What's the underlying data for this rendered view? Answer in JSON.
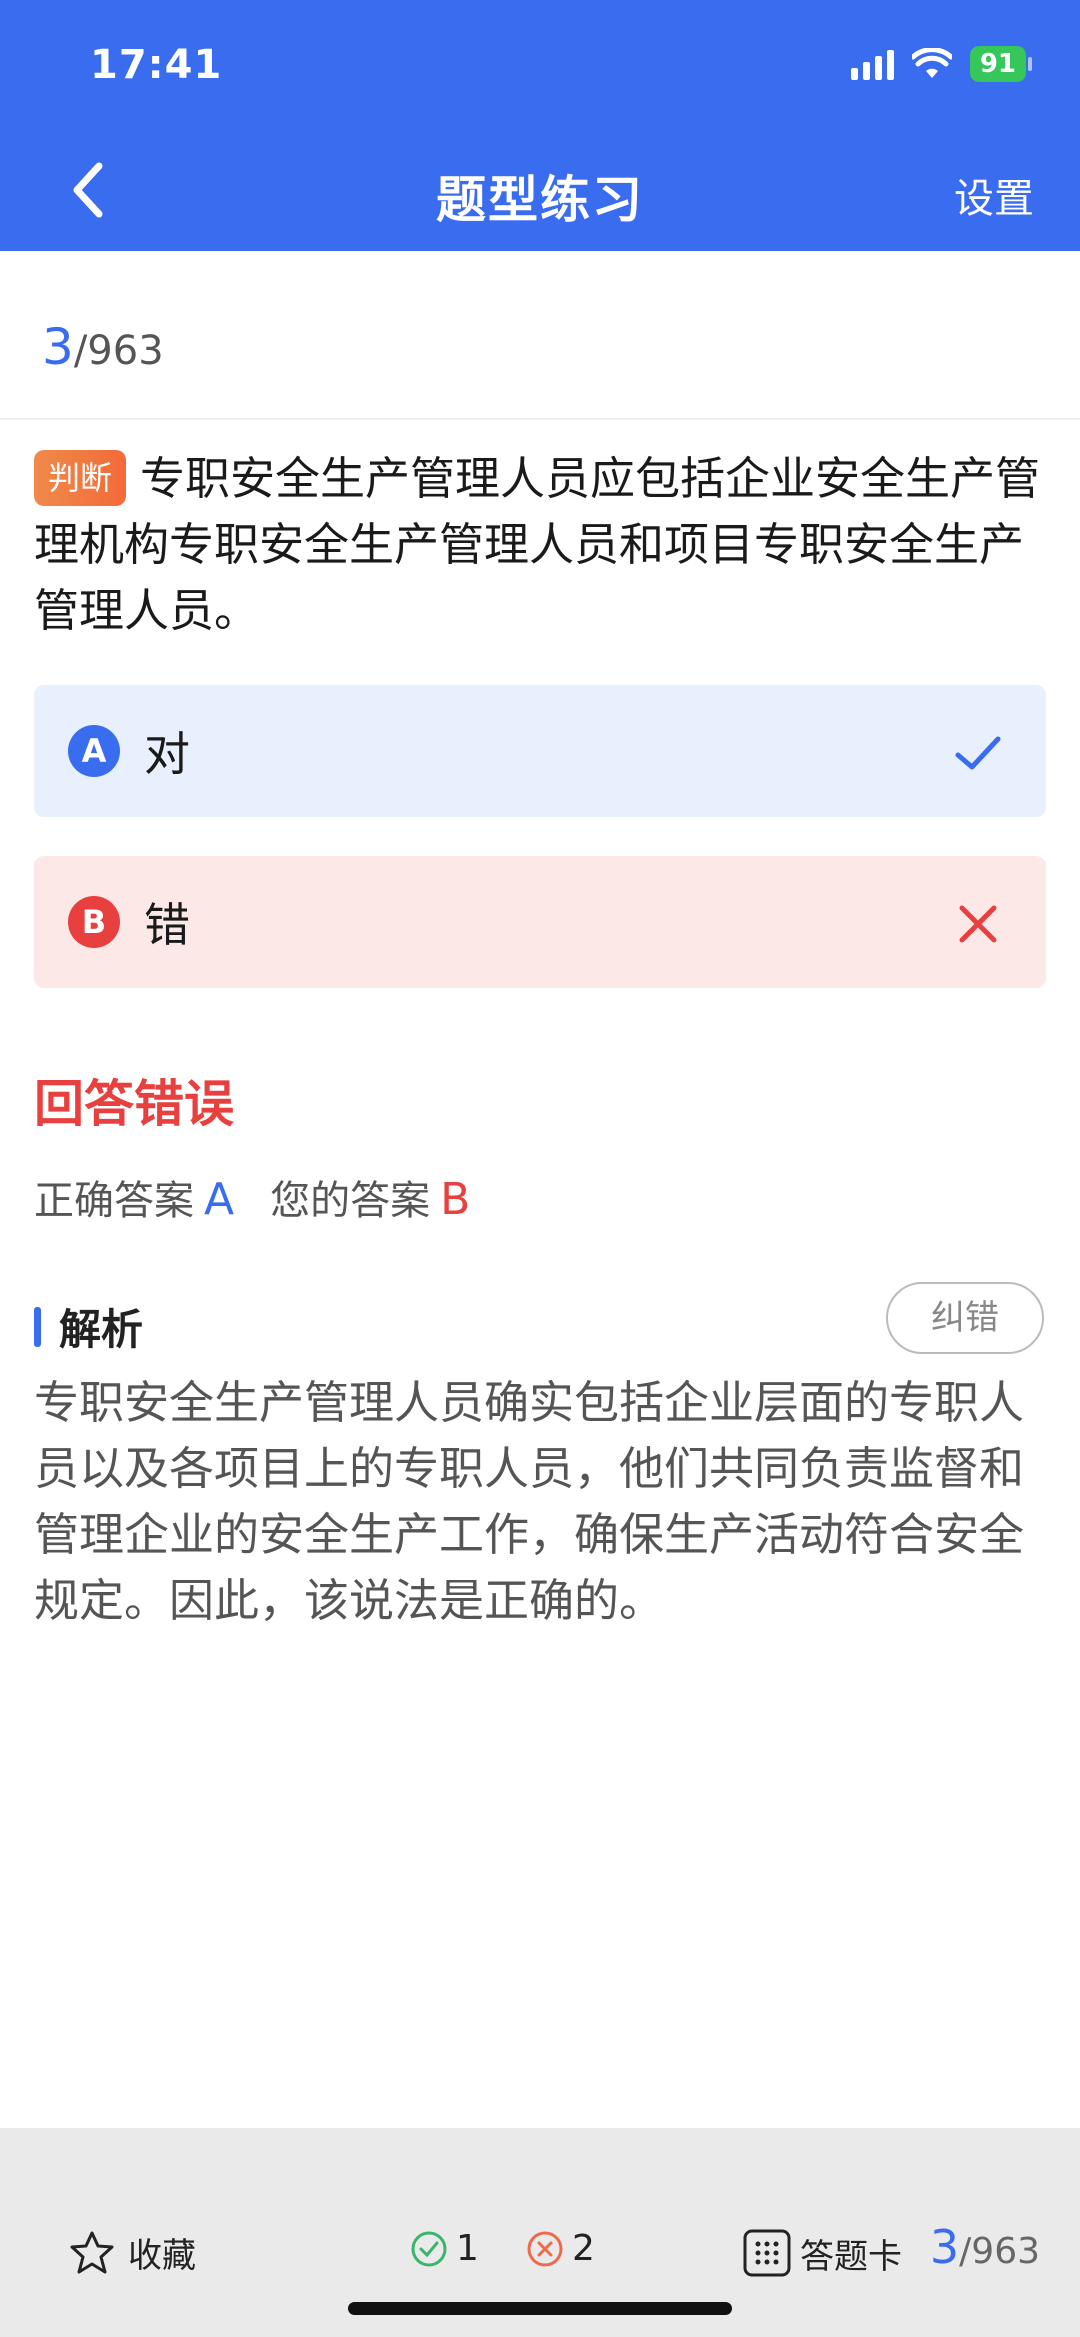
{
  "status": {
    "time": "17:41",
    "battery": "91"
  },
  "nav": {
    "title": "题型练习",
    "settings": "设置"
  },
  "progress": {
    "current": "3",
    "total": "/963"
  },
  "question": {
    "tag": "判断",
    "text": "专职安全生产管理人员应包括企业安全生产管理机构专职安全生产管理人员和项目专职安全生产管理人员。"
  },
  "options": [
    {
      "letter": "A",
      "text": "对",
      "state": "correct"
    },
    {
      "letter": "B",
      "text": "错",
      "state": "wrong"
    }
  ],
  "result": {
    "title": "回答错误",
    "correct_label": "正确答案",
    "correct_value": "A",
    "your_label": "您的答案",
    "your_value": "B"
  },
  "analysis": {
    "title": "解析",
    "report_button": "纠错",
    "text": "专职安全生产管理人员确实包括企业层面的专职人员以及各项目上的专职人员，他们共同负责监督和管理企业的安全生产工作，确保生产活动符合安全规定。因此，该说法是正确的。"
  },
  "bottom_bar": {
    "favorite_label": "收藏",
    "correct_count": "1",
    "wrong_count": "2",
    "answer_card_label": "答题卡",
    "current": "3",
    "total": "/963"
  },
  "colors": {
    "accent": "#3a6cf0",
    "error": "#e8403f",
    "success": "#35c759"
  }
}
